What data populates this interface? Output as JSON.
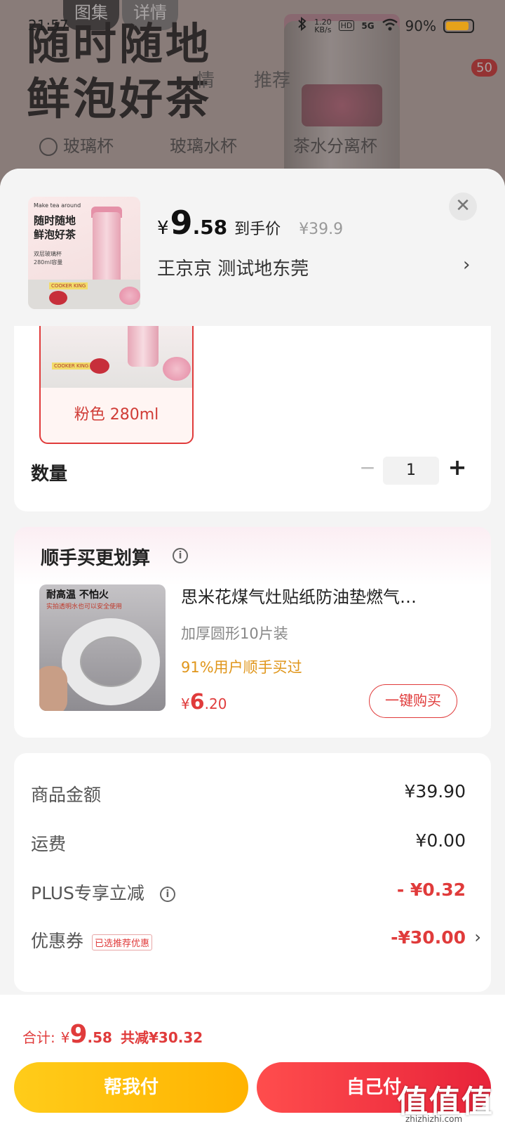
{
  "status_bar": {
    "time": "21:57",
    "net_speed_value": "1.20",
    "net_speed_unit": "KB/s",
    "hd": "HD",
    "signal": "5G",
    "battery": "90%",
    "battery_level": 0.9
  },
  "background": {
    "tabs": [
      "图集",
      "详情"
    ],
    "headline_line1": "随时随地",
    "headline_line2": "鲜泡好茶",
    "subnav": [
      "情",
      "推荐"
    ],
    "cart_badge": "50",
    "checks": [
      "玻璃杯",
      "玻璃水杯",
      "茶水分离杯"
    ]
  },
  "header": {
    "thumb_tag": "Make tea around",
    "thumb_title_1": "随时随地",
    "thumb_title_2": "鲜泡好茶",
    "thumb_bullet_1": "双层玻璃杯",
    "thumb_bullet_2": "280ml容量",
    "thumb_brand": "COOKER KING",
    "price_symbol": "¥",
    "price_int": "9",
    "price_dec": ".58",
    "price_label": "到手价",
    "price_original": "¥39.9",
    "address": "王京京  测试地东莞",
    "close": "✕",
    "chevron": "›"
  },
  "spec": {
    "brand": "COOKER KING",
    "selected_label": "粉色 280ml",
    "quantity_label": "数量",
    "minus": "−",
    "quantity": "1",
    "plus": "+"
  },
  "recommend": {
    "title": "顺手买更划算",
    "info": "i",
    "img_text1": "耐高温 不怕火",
    "img_text2": "实拍透明水也可以安全使用",
    "name": "思米花煤气灶贴纸防油垫燃气…",
    "spec": "加厚圆形10片装",
    "bought": "91%用户顺手买过",
    "price_symbol": "¥",
    "price_int": "6",
    "price_dec": ".20",
    "buy_label": "一键购买"
  },
  "summary": {
    "rows": [
      {
        "label": "商品金额",
        "value": "¥39.90"
      },
      {
        "label": "运费",
        "value": "¥0.00"
      },
      {
        "label": "PLUS专享立减",
        "value": "- ¥0.32"
      },
      {
        "label": "优惠券",
        "tag": "已选推荐优惠",
        "value": "-¥30.00"
      }
    ],
    "chevron": "›",
    "info": "i"
  },
  "footer": {
    "total_label": "合计:",
    "total_symbol": "¥",
    "total_int": "9",
    "total_dec": ".58",
    "saved": "共减¥30.32",
    "help_pay": "帮我付",
    "self_pay": "自己付",
    "watermark": "值值值",
    "watermark_sub": "zhizhizhi.com"
  },
  "colors": {
    "accent_red": "#e03b3b",
    "accent_yellow": "#ffb300",
    "orange_text": "#e0961b"
  }
}
